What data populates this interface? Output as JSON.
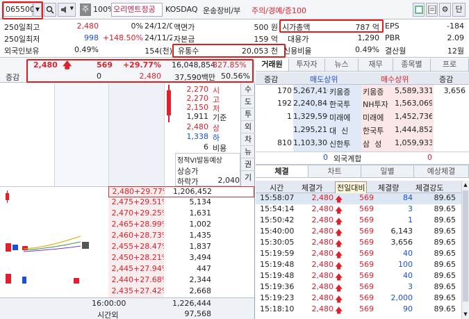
{
  "toolbar": {
    "code": "065500",
    "name": "오리엔트정공",
    "market": "KOSDAQ",
    "sector": "운송장비/부",
    "warn": "주의/경예/증100",
    "pct": "100%",
    "ju": "주",
    "btn_dan": "단"
  },
  "info": {
    "r1": {
      "l": "250일최고",
      "v": "2,480",
      "p": "0%",
      "d": "24/12/06",
      "l2": "액면가",
      "v2": "500 원",
      "l3": "시가총액",
      "v3": "787 억",
      "l4": "EPS",
      "v4": "-184"
    },
    "r2": {
      "l": "250일최저",
      "v": "998",
      "p": "+148.50%",
      "d": "24/11/21",
      "l2": "자본금",
      "v2": "159 억",
      "l3": "대용가",
      "v3": "1,290",
      "l4": "PBR",
      "v4": "2.09"
    },
    "r3": {
      "l": "외국인보유",
      "v": "0.49%",
      "p": "154(천)",
      "l2": "유통수",
      "v2": "20,053 천",
      "l3": "신용비율",
      "v3": "0.49%",
      "l4": "결산월",
      "v4": "12월"
    }
  },
  "price": {
    "cur": "2,480",
    "diff": "569",
    "rate": "+29.77%",
    "vol": "16,048,854",
    "vrate": "827.85%",
    "label_jg": "증감",
    "jg": "0",
    "jg2": "2,480",
    "amount": "37,590백만",
    "r2": "50.56%"
  },
  "info_side": [
    {
      "v": "2,270",
      "k": "시"
    },
    {
      "v": "2,270",
      "k": "고"
    },
    {
      "v": "2,150",
      "k": "저"
    },
    {
      "v": "1,911",
      "k": "기준"
    },
    {
      "v": "2,480",
      "k": "상"
    },
    {
      "v": "1,338",
      "k": "하"
    },
    {
      "v": "6",
      "k": "비용"
    }
  ],
  "vi": {
    "t": "정적VI발동예상",
    "up": "상승가",
    "down": "하락가",
    "down_v": "2,040"
  },
  "vtabs": [
    "수",
    "도",
    "투",
    "외",
    "차",
    "뉴",
    "권",
    "기"
  ],
  "hoga": [
    {
      "p": "2,480",
      "r": "+29.77%",
      "q": "1,206,452"
    },
    {
      "p": "2,475",
      "r": "+29.51%",
      "q": "5,134"
    },
    {
      "p": "2,470",
      "r": "+29.25%",
      "q": "1,631"
    },
    {
      "p": "2,465",
      "r": "+28.99%",
      "q": "1,002"
    },
    {
      "p": "2,460",
      "r": "+28.73%",
      "q": "1,435"
    },
    {
      "p": "2,455",
      "r": "+28.47%",
      "q": "1,837"
    },
    {
      "p": "2,450",
      "r": "+28.21%",
      "q": "3,494"
    },
    {
      "p": "2,445",
      "r": "+27.94%",
      "q": "447"
    },
    {
      "p": "2,440",
      "r": "+27.68%",
      "q": "2,344"
    },
    {
      "p": "2,435",
      "r": "+27.42%",
      "q": "2,668"
    }
  ],
  "bottom": {
    "t1": "16:00:00",
    "v1": "1,226,444",
    "t2": "시간외",
    "v2": "97,568"
  },
  "rtabs": [
    "거래원",
    "투자자",
    "뉴스",
    "재무",
    "종목별",
    "프로"
  ],
  "broker_head": {
    "c1": "증감",
    "c2": "매도상위",
    "c3": "매수상위",
    "c4": "증감"
  },
  "brokers": [
    {
      "a": "170",
      "b": "5,267,410",
      "c": "키움증",
      "d": "키움증",
      "e": "5,589,331",
      "f": "3,656"
    },
    {
      "a": "192",
      "b": "2,240,843",
      "c": "한국투",
      "d": "NH투자",
      "e": "1,563,069",
      "f": ""
    },
    {
      "a": "1",
      "b": "1,329,590",
      "c": "미래에",
      "d": "미래에",
      "e": "1,452,736",
      "f": ""
    },
    {
      "a": "",
      "b": "1,295,211",
      "c": "대  신",
      "d": "한국투",
      "e": "1,444,852",
      "f": ""
    },
    {
      "a": "810",
      "b": "1,103,308",
      "c": "신한투",
      "d": "삼  성",
      "e": "1,059,933",
      "f": ""
    }
  ],
  "foreign": {
    "a": "0",
    "l": "외국계합",
    "b": "0"
  },
  "ttabs": [
    "체결",
    "차트",
    "일별",
    "예상체결"
  ],
  "trade_head": {
    "t": "시간",
    "p": "체결가",
    "d": "전일대비",
    "q": "체결량",
    "s": "체결강도"
  },
  "trades": [
    {
      "t": "15:58:07",
      "p": "2,480",
      "d": "569",
      "q": "84",
      "s": "89.65"
    },
    {
      "t": "15:54:14",
      "p": "2,480",
      "d": "569",
      "q": "3",
      "s": "89.65"
    },
    {
      "t": "15:50:42",
      "p": "2,480",
      "d": "569",
      "q": "1",
      "s": "89.65"
    },
    {
      "t": "15:40:00",
      "p": "2,480",
      "d": "569",
      "q": "6,143",
      "s": "89.65"
    },
    {
      "t": "15:30:05",
      "p": "2,480",
      "d": "569",
      "q": "3,656",
      "s": "89.65"
    },
    {
      "t": "15:19:59",
      "p": "2,480",
      "d": "569",
      "q": "40",
      "s": "89.65"
    },
    {
      "t": "15:19:48",
      "p": "2,480",
      "d": "569",
      "q": "100",
      "s": "89.65"
    },
    {
      "t": "15:19:48",
      "p": "2,480",
      "d": "569",
      "q": "40",
      "s": "89.65"
    },
    {
      "t": "15:19:36",
      "p": "2,480",
      "d": "569",
      "q": "3",
      "s": "89.65"
    },
    {
      "t": "15:19:23",
      "p": "2,480",
      "d": "569",
      "q": "2,000",
      "s": "89.65"
    },
    {
      "t": "15:18:10",
      "p": "2,480",
      "d": "569",
      "q": "90",
      "s": "89.65"
    }
  ],
  "colors": {
    "up": "#e0202a",
    "down": "#1a4fd6",
    "header": "#e4e8f0",
    "sell_bg": "#dfe9f7",
    "buy_bg": "#fbe7e7"
  },
  "icons": [
    "search-icon",
    "speaker-icon",
    "grid-icon",
    "doc-icon",
    "gear-icon",
    "caret-down-icon",
    "up-arrow-icon"
  ]
}
